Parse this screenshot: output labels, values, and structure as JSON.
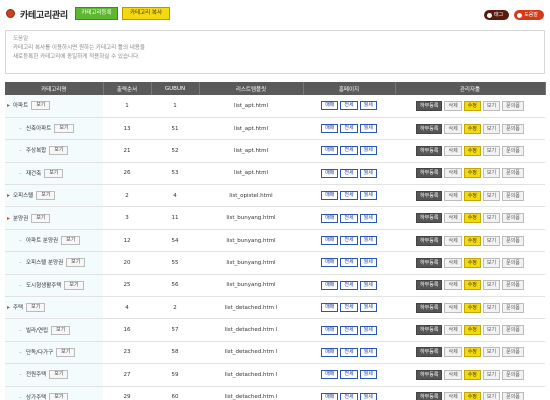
{
  "header": {
    "title": "카테고리관리",
    "register_label": "카테고리등록",
    "copy_label": "카테고리 복사",
    "tag_label": "태그",
    "help_label": "도움말"
  },
  "help": {
    "title": "도움말",
    "line1": "카테고리 복사를 이용하시면 원하는 카테고리 틀의 내용을",
    "line2": "새로등록한 카테고리에 동일하게 적용하실 수 있습니다."
  },
  "table": {
    "columns": [
      "카테고리명",
      "출력순서",
      "GUBUN",
      "리스트템플릿",
      "홈페이지",
      "관리자툴"
    ],
    "view_label": "보기",
    "skin_buttons": [
      "매매",
      "전세",
      "월세"
    ],
    "actions": [
      "하부등록",
      "삭제",
      "수정",
      "보기",
      "문의폼"
    ],
    "rows": [
      {
        "name": "아파트",
        "level": 0,
        "order": "1",
        "gubun": "1",
        "template": "list_apt.html"
      },
      {
        "name": "신축아파트",
        "level": 1,
        "order": "13",
        "gubun": "51",
        "template": "list_apt.html"
      },
      {
        "name": "주상복합",
        "level": 1,
        "order": "21",
        "gubun": "52",
        "template": "list_apt.html"
      },
      {
        "name": "재건축",
        "level": 1,
        "order": "26",
        "gubun": "53",
        "template": "list_apt.html"
      },
      {
        "name": "오피스텔",
        "level": 0,
        "order": "2",
        "gubun": "4",
        "template": "list_opistel.html"
      },
      {
        "name": "분양권",
        "level": 0,
        "order": "3",
        "gubun": "11",
        "template": "list_bunyang.html"
      },
      {
        "name": "아파트 분양권",
        "level": 1,
        "order": "12",
        "gubun": "54",
        "template": "list_bunyang.html"
      },
      {
        "name": "오피스텔 분양권",
        "level": 1,
        "order": "20",
        "gubun": "55",
        "template": "list_bunyang.html"
      },
      {
        "name": "도시형생활주택",
        "level": 1,
        "order": "25",
        "gubun": "56",
        "template": "list_bunyang.html"
      },
      {
        "name": "주택",
        "level": 0,
        "order": "4",
        "gubun": "2",
        "template": "list_detached.htm l"
      },
      {
        "name": "빌라/연립",
        "level": 1,
        "order": "16",
        "gubun": "57",
        "template": "list_detached.htm l"
      },
      {
        "name": "단독/다가구",
        "level": 1,
        "order": "23",
        "gubun": "58",
        "template": "list_detached.htm l"
      },
      {
        "name": "전원주택",
        "level": 1,
        "order": "27",
        "gubun": "59",
        "template": "list_detached.htm l"
      },
      {
        "name": "상가주택",
        "level": 1,
        "order": "29",
        "gubun": "60",
        "template": "list_detached.htm l"
      }
    ]
  }
}
